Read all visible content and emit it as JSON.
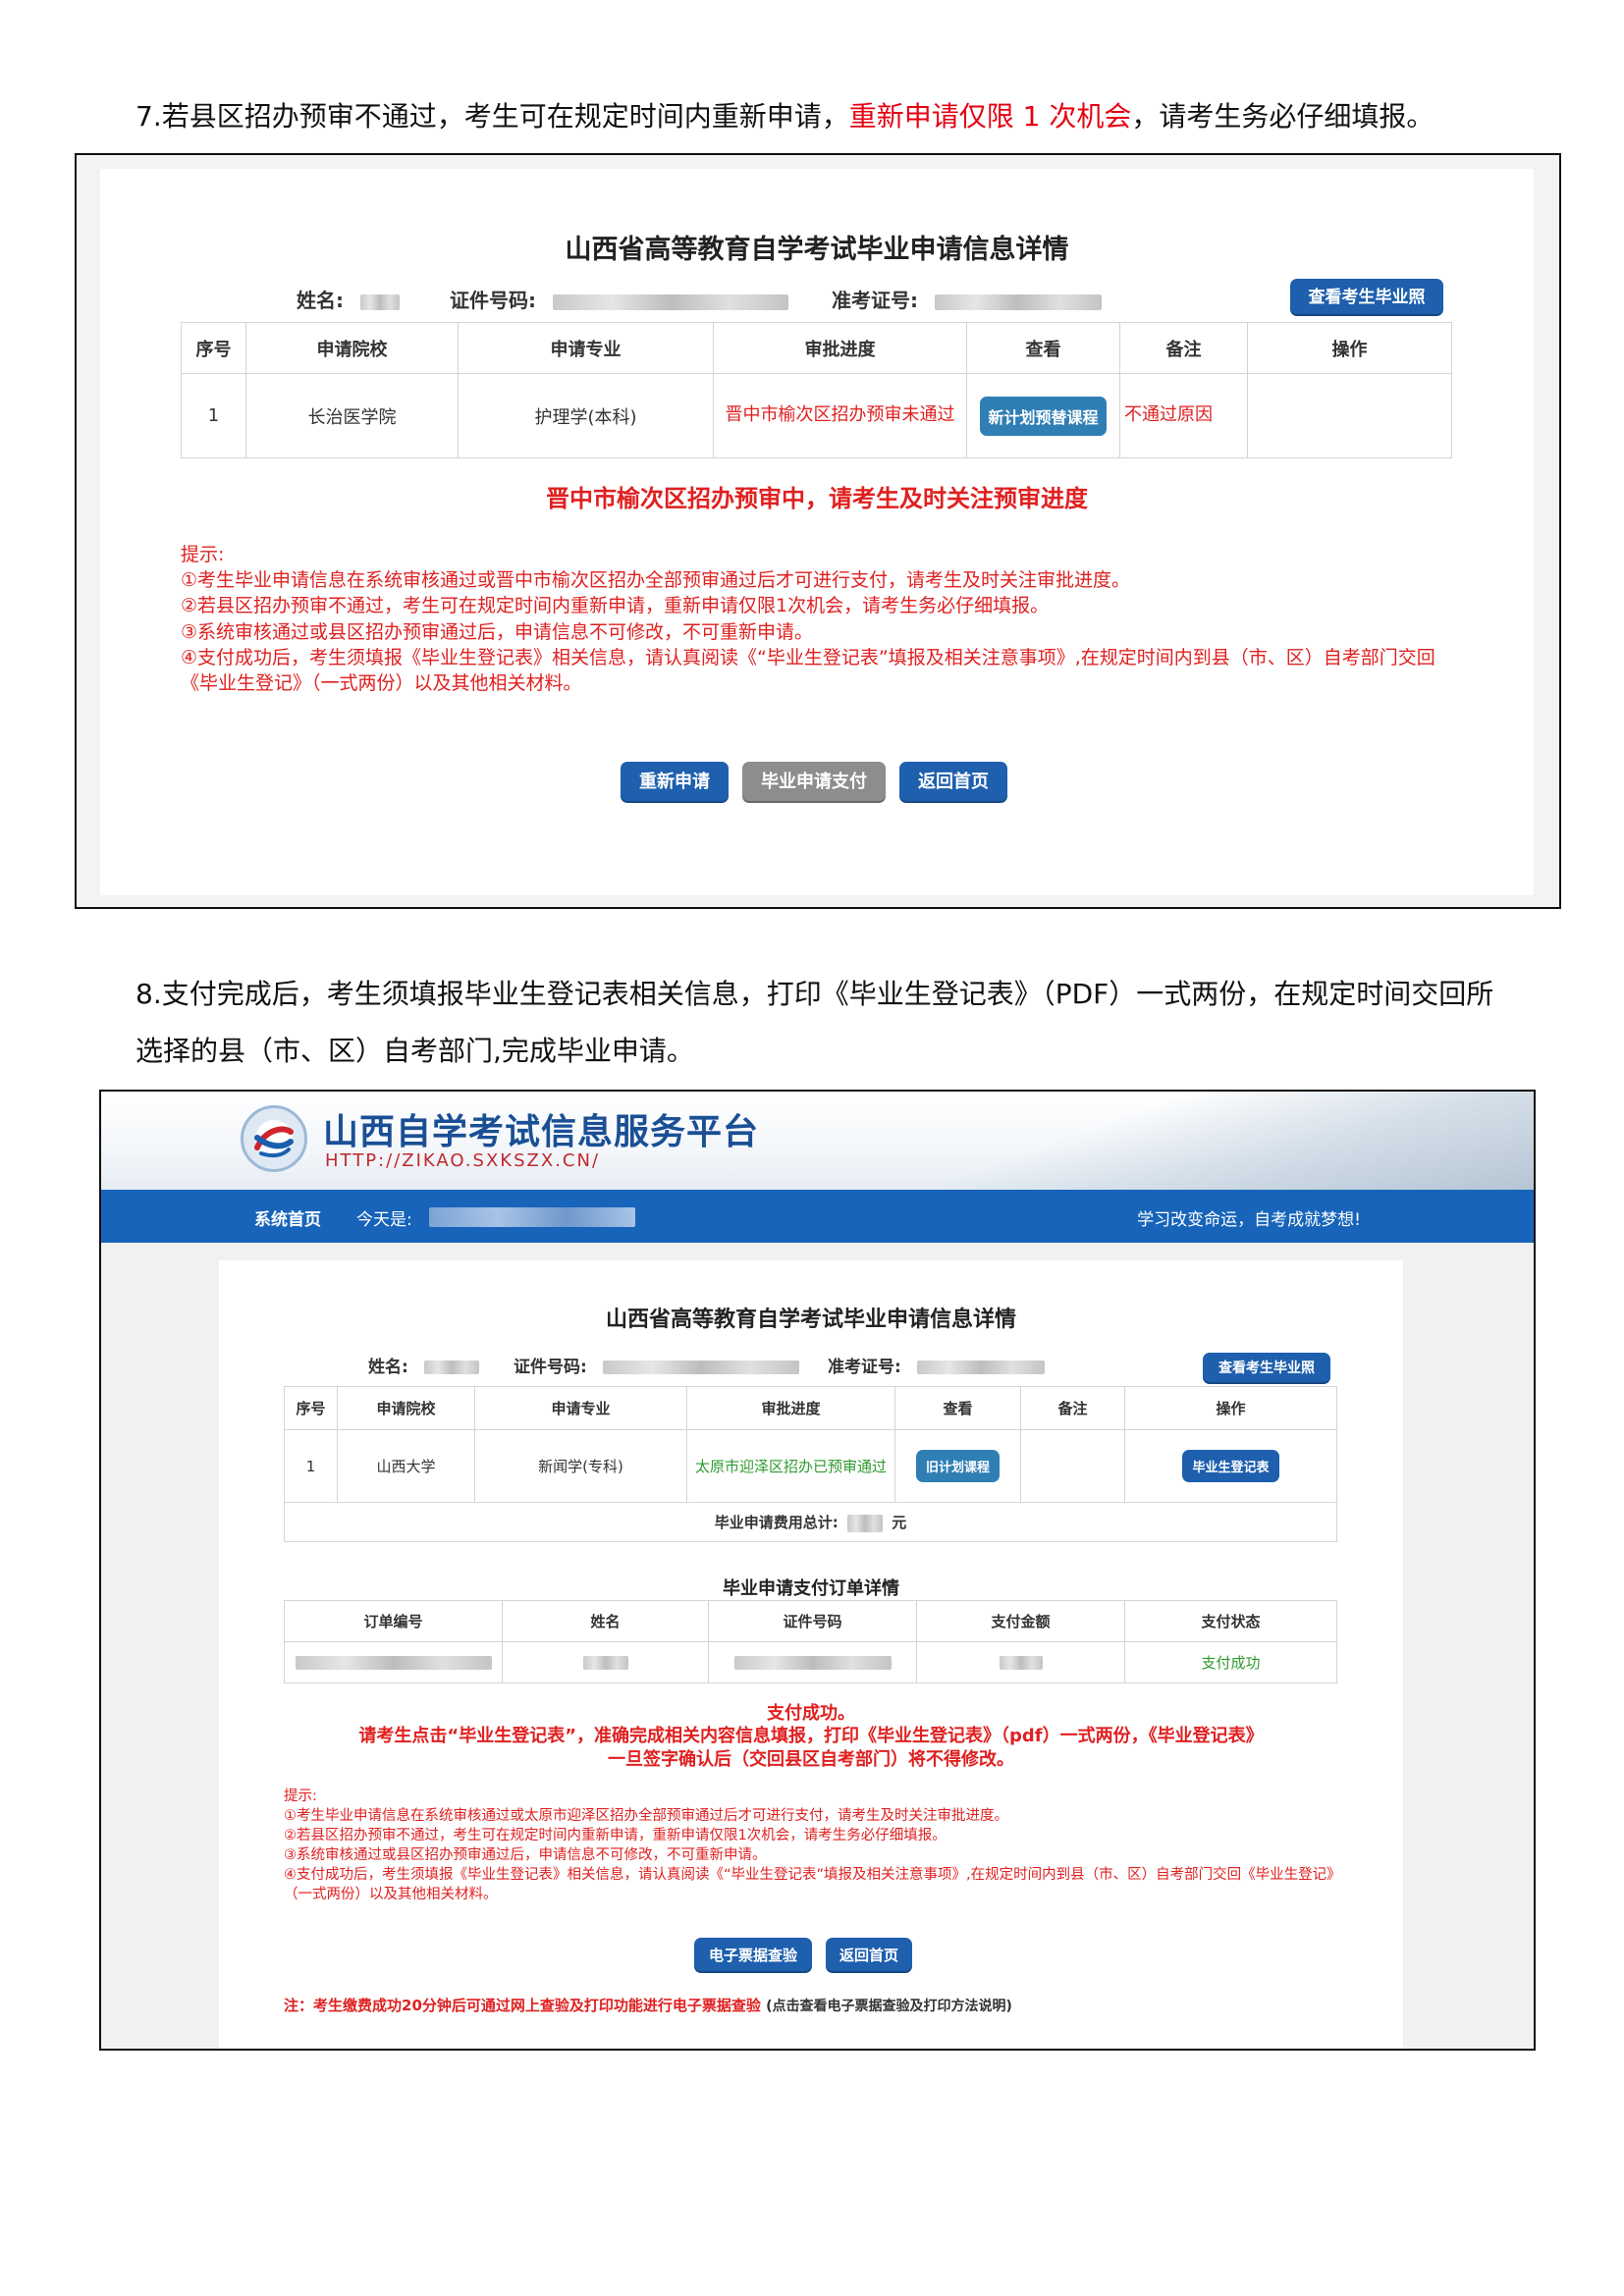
{
  "step7": {
    "text_before": "7.若县区招办预审不通过，考生可在规定时间内重新申请，",
    "text_red": "重新申请仅限 1 次机会",
    "text_after": "，请考生务必仔细填报。"
  },
  "screen1": {
    "title": "山西省高等教育自学考试毕业申请信息详情",
    "name_label": "姓名:",
    "id_label": "证件号码:",
    "exam_no_label": "准考证号:",
    "view_cert_button": "查看考生毕业照",
    "table": {
      "headers": [
        "序号",
        "申请院校",
        "申请专业",
        "审批进度",
        "查看",
        "备注",
        "操作"
      ],
      "row": {
        "no": "1",
        "school": "长治医学院",
        "major": "护理学(本科)",
        "progress": "晋中市榆次区招办预审未通过",
        "view_button": "新计划预替课程",
        "remark": "不通过原因"
      }
    },
    "status_notice": "晋中市榆次区招办预审中，请考生及时关注预审进度",
    "tips_heading": "提示:",
    "tips": [
      "①考生毕业申请信息在系统审核通过或晋中市榆次区招办全部预审通过后才可进行支付，请考生及时关注审批进度。",
      "②若县区招办预审不通过，考生可在规定时间内重新申请，重新申请仅限1次机会，请考生务必仔细填报。",
      "③系统审核通过或县区招办预审通过后，申请信息不可修改，不可重新申请。",
      "④支付成功后，考生须填报《毕业生登记表》相关信息，请认真阅读《“毕业生登记表”填报及相关注意事项》,在规定时间内到县（市、区）自考部门交回《毕业生登记》（一式两份）以及其他相关材料。"
    ],
    "buttons": {
      "reapply": "重新申请",
      "pay": "毕业申请支付",
      "home": "返回首页"
    }
  },
  "step8": {
    "line1": "8.支付完成后，考生须填报毕业生登记表相关信息，打印《毕业生登记表》（PDF）一式两份，在规定时间交回所",
    "line2": "选择的县（市、区）自考部门,完成毕业申请。"
  },
  "screen2": {
    "site_title": "山西自学考试信息服务平台",
    "site_url": "HTTP://ZIKAO.SXKSZX.CN/",
    "nav": {
      "home": "系统首页",
      "today_label": "今天是:",
      "slogan": "学习改变命运，自考成就梦想!"
    },
    "title": "山西省高等教育自学考试毕业申请信息详情",
    "name_label": "姓名:",
    "id_label": "证件号码:",
    "exam_no_label": "准考证号:",
    "view_cert_button": "查看考生毕业照",
    "table": {
      "headers": [
        "序号",
        "申请院校",
        "申请专业",
        "审批进度",
        "查看",
        "备注",
        "操作"
      ],
      "row": {
        "no": "1",
        "school": "山西大学",
        "major": "新闻学(专科)",
        "progress": "太原市迎泽区招办已预审通过",
        "view_button": "旧计划课程",
        "action_button": "毕业生登记表"
      },
      "fee_label": "毕业申请费用总计:",
      "fee_unit": "元"
    },
    "order_title": "毕业申请支付订单详情",
    "order_table": {
      "headers": [
        "订单编号",
        "姓名",
        "证件号码",
        "支付金额",
        "支付状态"
      ],
      "status": "支付成功"
    },
    "notice": [
      "支付成功。",
      "请考生点击“毕业生登记表”，准确完成相关内容信息填报，打印《毕业生登记表》（pdf）一式两份，《毕业登记表》",
      "一旦签字确认后（交回县区自考部门）将不得修改。"
    ],
    "tips_heading": "提示:",
    "tips": [
      "①考生毕业申请信息在系统审核通过或太原市迎泽区招办全部预审通过后才可进行支付，请考生及时关注审批进度。",
      "②若县区招办预审不通过，考生可在规定时间内重新申请，重新申请仅限1次机会，请考生务必仔细填报。",
      "③系统审核通过或县区招办预审通过后，申请信息不可修改，不可重新申请。",
      "④支付成功后，考生须填报《毕业生登记表》相关信息，请认真阅读《“毕业生登记表”填报及相关注意事项》,在规定时间内到县（市、区）自考部门交回《毕业生登记》（一式两份）以及其他相关材料。"
    ],
    "buttons": {
      "invoice": "电子票据查验",
      "home": "返回首页"
    },
    "footer_note": "注：考生缴费成功20分钟后可通过网上查验及打印功能进行电子票据查验",
    "footer_link": "(点击查看电子票据查验及打印方法说明)"
  }
}
